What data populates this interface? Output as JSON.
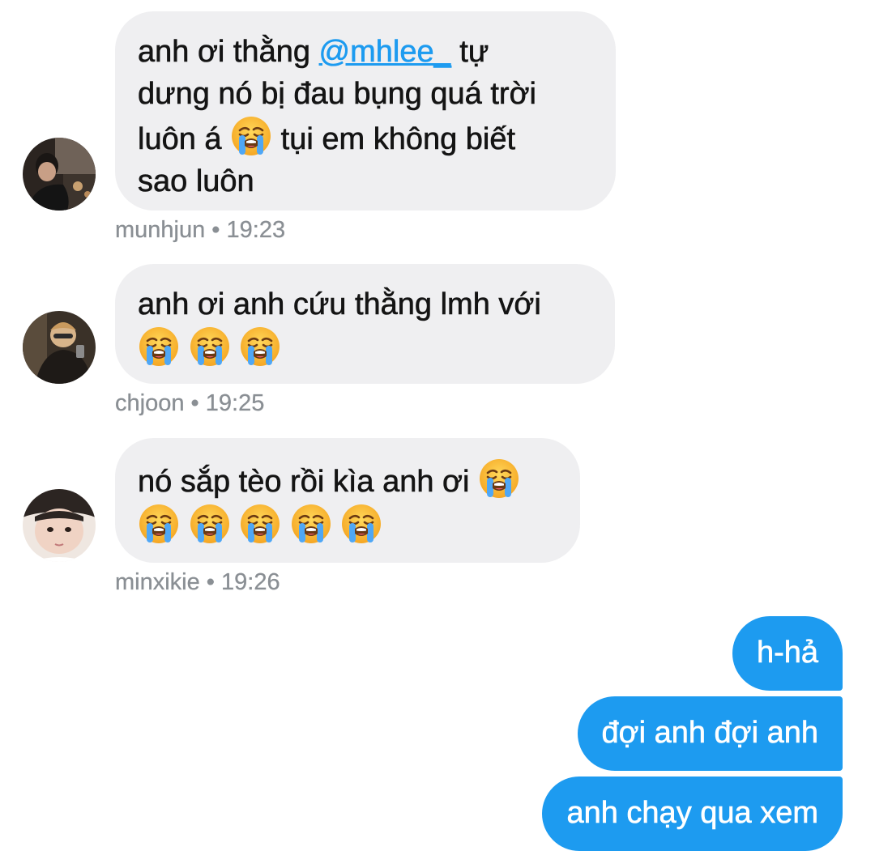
{
  "colors": {
    "incoming_bubble": "#efeff1",
    "outgoing_bubble": "#1d9bf0",
    "mention": "#1d9bf0",
    "meta_text": "#8a8f94"
  },
  "messages": [
    {
      "sender": "munhjun",
      "time": "19:23",
      "avatar": "avatar-munhjun",
      "lines": [
        {
          "before": "anh ơi thằng ",
          "mention": "@mhlee_",
          "after": " tự"
        },
        {
          "text": "dưng nó bị đau bụng quá trời"
        },
        {
          "before": "luôn á ",
          "emoji": "loudly-crying-face-emoji",
          "after": " tụi em không biết"
        },
        {
          "text": "sao luôn"
        }
      ]
    },
    {
      "sender": "chjoon",
      "time": "19:25",
      "avatar": "avatar-chjoon",
      "lines": [
        {
          "text": "anh ơi anh cứu thằng lmh với"
        },
        {
          "emojis": [
            "loudly-crying-face-emoji",
            "loudly-crying-face-emoji",
            "loudly-crying-face-emoji"
          ]
        }
      ]
    },
    {
      "sender": "minxikie",
      "time": "19:26",
      "avatar": "avatar-minxikie",
      "lines": [
        {
          "before": "nó sắp tèo rồi kìa anh ơi ",
          "emoji": "loudly-crying-face-emoji"
        },
        {
          "emojis": [
            "loudly-crying-face-emoji",
            "loudly-crying-face-emoji",
            "loudly-crying-face-emoji",
            "loudly-crying-face-emoji",
            "loudly-crying-face-emoji"
          ]
        }
      ]
    }
  ],
  "outgoing": [
    {
      "text": "h-hả"
    },
    {
      "text": "đợi anh đợi anh"
    },
    {
      "text": "anh chạy qua xem"
    }
  ],
  "meta_separator": " • "
}
